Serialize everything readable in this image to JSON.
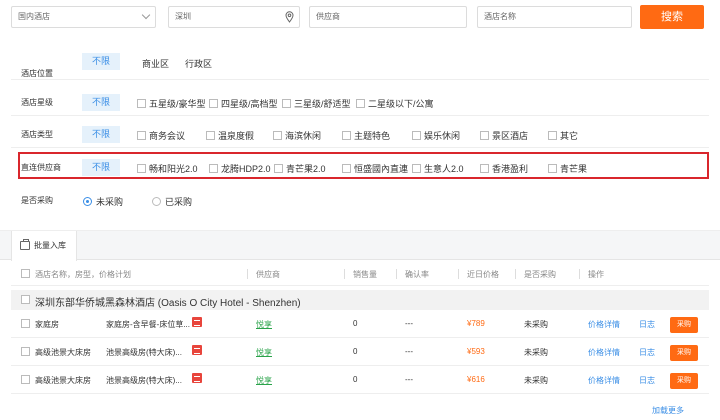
{
  "search": {
    "scope": "国内酒店",
    "city": "深圳",
    "supplier_placeholder": "供应商",
    "hotel_placeholder": "酒店名称",
    "search_button": "搜索"
  },
  "filters": {
    "unlimited": "不限",
    "location": {
      "label": "酒店位置",
      "options": [
        "商业区",
        "行政区"
      ]
    },
    "star": {
      "label": "酒店星级",
      "options": [
        "五星级/豪华型",
        "四星级/高档型",
        "三星级/舒适型",
        "二星级以下/公寓"
      ]
    },
    "type": {
      "label": "酒店类型",
      "options": [
        "商务会议",
        "温泉度假",
        "海滨休闲",
        "主题特色",
        "娱乐休闲",
        "景区酒店",
        "其它"
      ]
    },
    "supplier": {
      "label": "直连供应商",
      "options": [
        "畅和阳光2.0",
        "龙腾HDP2.0",
        "青芒果2.0",
        "恒盛國內直連",
        "生意人2.0",
        "香港盈利",
        "青芒果"
      ]
    },
    "purchased": {
      "label": "是否采购",
      "options": [
        "未采购",
        "已采购"
      ],
      "selected": "未采购"
    }
  },
  "toolbar": {
    "batch_import": "批量入库"
  },
  "table": {
    "headers": [
      "酒店名称，房型，价格计划",
      "供应商",
      "销售量",
      "确认率",
      "近日价格",
      "是否采购",
      "操作"
    ],
    "hotel_name": "深圳东部华侨城黑森林酒店 (Oasis O City Hotel - Shenzhen)",
    "rows": [
      {
        "room": "家庭房",
        "plan": "家庭房-含早餐-床位草...",
        "supplier": "悦享",
        "sales": "0",
        "confirm": "---",
        "price": "¥789",
        "status": "未采购",
        "detail": "价格详情",
        "log": "日志",
        "buy": "采购"
      },
      {
        "room": "高级池景大床房",
        "plan": "池景高级房(特大床)...",
        "supplier": "悦享",
        "sales": "0",
        "confirm": "---",
        "price": "¥593",
        "status": "未采购",
        "detail": "价格详情",
        "log": "日志",
        "buy": "采购"
      },
      {
        "room": "高级池景大床房",
        "plan": "池景高级房(特大床)...",
        "supplier": "悦享",
        "sales": "0",
        "confirm": "---",
        "price": "¥616",
        "status": "未采购",
        "detail": "价格详情",
        "log": "日志",
        "buy": "采购"
      }
    ],
    "load_more": "加载更多"
  },
  "colors": {
    "accent": "#ff6a13",
    "link": "#3a8ee6",
    "highlight_border": "#d9262c",
    "supplier": "#2aa34a"
  }
}
